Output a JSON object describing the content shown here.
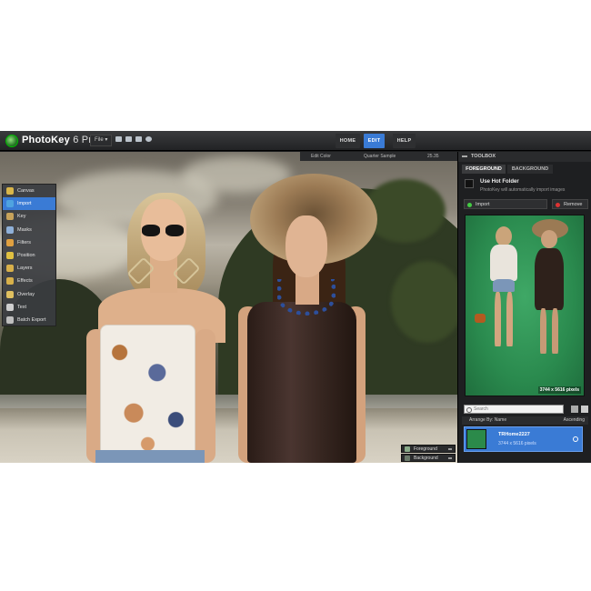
{
  "app": {
    "title_main": "PhotoKey",
    "title_sub": "6 Pro",
    "file_menu": "File ▾"
  },
  "nav": {
    "home": "HOME",
    "edit": "EDIT",
    "help": "HELP"
  },
  "subbar": {
    "edit_color": "Edit Color",
    "quality": "Quarter Sample",
    "zoom": "25.35"
  },
  "tools": [
    "Canvas",
    "Import",
    "Key",
    "Masks",
    "Filters",
    "Position",
    "Layers",
    "Effects",
    "Overlay",
    "Text",
    "Batch Export"
  ],
  "tool_colors": [
    "#d9b64a",
    "#4fa3e0",
    "#c7a25a",
    "#8fb0d8",
    "#e0a040",
    "#e0c040",
    "#d8b04a",
    "#d8b04a",
    "#e0c060",
    "#cfcfcf",
    "#bfbfbf"
  ],
  "selected_tool": "Import",
  "layers": {
    "foreground": "Foreground",
    "background": "Background"
  },
  "toolbox": {
    "title": "TOOLBOX",
    "tab_foreground": "FOREGROUND",
    "tab_background": "BACKGROUND",
    "hot_folder_label": "Use Hot Folder",
    "hot_folder_desc": "PhotoKey will automatically import images",
    "import_label": "Import",
    "remove_label": "Remove",
    "preview_dims": "3744 x 5616 pixels",
    "search_placeholder": "Search",
    "arrange_label": "Arrange By: Name",
    "sort_label": "Ascending",
    "item_name": "TRHome2227",
    "item_info": "3744 x 5616 pixels"
  },
  "colors": {
    "accent": "#3a7bd5",
    "green_screen": "#2a8a4e"
  }
}
